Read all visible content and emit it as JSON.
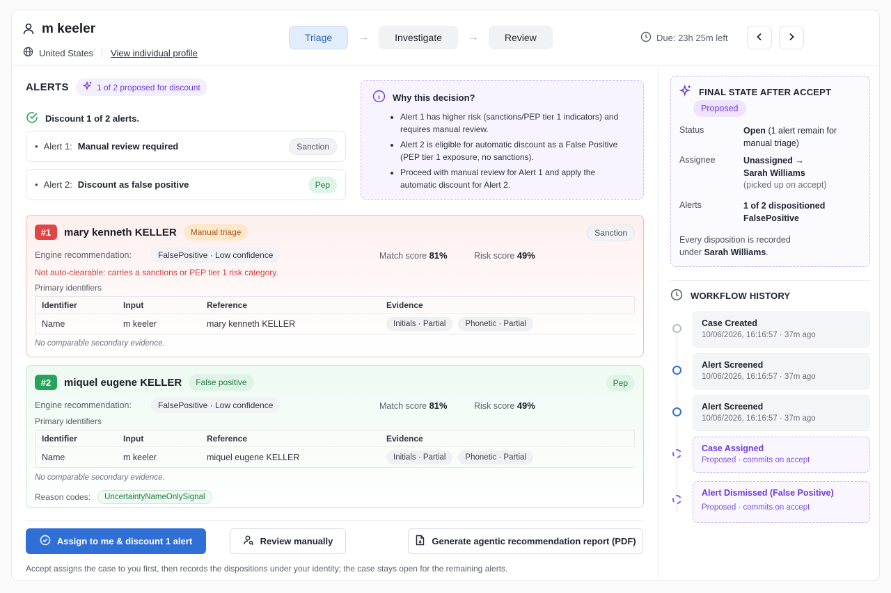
{
  "header": {
    "user_name": "m keeler",
    "country": "United States",
    "profile_link": "View individual profile",
    "steps": [
      {
        "label": "Triage",
        "active": true
      },
      {
        "label": "Investigate",
        "active": false
      },
      {
        "label": "Review",
        "active": false
      }
    ],
    "due": "Due: 23h 25m left"
  },
  "alerts": {
    "title": "ALERTS",
    "proposed_chip": "1 of 2 proposed for discount",
    "discount_summary": "Discount 1 of 2 alerts.",
    "rows": [
      {
        "label": "Alert 1:",
        "value": "Manual review required",
        "tag": "Sanction"
      },
      {
        "label": "Alert 2:",
        "value": "Discount as false positive",
        "tag": "Pep"
      }
    ]
  },
  "why": {
    "title": "Why this decision?",
    "bullets": [
      "Alert 1 has higher risk (sanctions/PEP tier 1 indicators) and requires manual review.",
      "Alert 2 is eligible for automatic discount as a False Positive (PEP tier 1 exposure, no sanctions).",
      "Proceed with manual review for Alert 1 and apply the automatic discount for Alert 2."
    ]
  },
  "cards": [
    {
      "num": "#1",
      "name": "mary kenneth KELLER",
      "status": "Manual triage",
      "type_tag": "Sanction",
      "engine_label": "Engine recommendation:",
      "engine_value": "FalsePositive · Low confidence",
      "match_label": "Match score",
      "match_value": "81%",
      "risk_label": "Risk score",
      "risk_value": "49%",
      "warning": "Not auto-clearable: carries a sanctions or PEP tier 1 risk category.",
      "primary_label": "Primary identifiers",
      "table_headers": [
        "Identifier",
        "Input",
        "Reference",
        "Evidence"
      ],
      "row": {
        "identifier": "Name",
        "input": "m keeler",
        "reference": "mary kenneth KELLER",
        "evidence": [
          "Initials · Partial",
          "Phonetic · Partial"
        ]
      },
      "secondary": "No comparable secondary evidence."
    },
    {
      "num": "#2",
      "name": "miquel eugene KELLER",
      "status": "False positive",
      "type_tag": "Pep",
      "engine_label": "Engine recommendation:",
      "engine_value": "FalsePositive · Low confidence",
      "match_label": "Match score",
      "match_value": "81%",
      "risk_label": "Risk score",
      "risk_value": "49%",
      "primary_label": "Primary identifiers",
      "table_headers": [
        "Identifier",
        "Input",
        "Reference",
        "Evidence"
      ],
      "row": {
        "identifier": "Name",
        "input": "m keeler",
        "reference": "miquel eugene KELLER",
        "evidence": [
          "Initials · Partial",
          "Phonetic · Partial"
        ]
      },
      "secondary": "No comparable secondary evidence.",
      "reason_label": "Reason codes:",
      "reason_value": "UncertaintyNameOnlySignal"
    }
  ],
  "actions": {
    "assign": "Assign to me & discount 1 alert",
    "review": "Review manually",
    "report": "Generate agentic recommendation report (PDF)",
    "footnote": "Accept assigns the case to you first, then records the dispositions under your identity; the case stays open for the remaining alerts."
  },
  "final_state": {
    "title": "FINAL STATE AFTER ACCEPT",
    "tag": "Proposed",
    "status_label": "Status",
    "status_value": "Open",
    "status_note": "(1 alert remain for manual triage)",
    "assignee_label": "Assignee",
    "assignee_value": "Unassigned →",
    "assignee_name": "Sarah Williams",
    "assignee_note": "(picked up on accept)",
    "alerts_label": "Alerts",
    "alerts_value": "1 of 2 dispositioned",
    "alerts_value2": "FalsePositive",
    "every_text": "Every disposition is recorded",
    "every_text2": "under",
    "every_name": "Sarah Williams",
    "every_end": "."
  },
  "workflow": {
    "title": "WORKFLOW HISTORY",
    "events": [
      {
        "title": "Case Created",
        "sub": "10/06/2026, 16:16:57 · 37m ago",
        "kind": "done"
      },
      {
        "title": "Alert Screened",
        "sub": "10/06/2026, 16:16:57 · 37m ago",
        "kind": "blue"
      },
      {
        "title": "Alert Screened",
        "sub": "10/06/2026, 16:16:57 · 37m ago",
        "kind": "blue"
      },
      {
        "title": "Case Assigned",
        "sub": "Proposed · commits on accept",
        "kind": "proposed"
      },
      {
        "title": "Alert Dismissed (False Positive)",
        "sub": "Proposed · commits on accept",
        "kind": "proposed"
      }
    ]
  },
  "colors": {
    "accent": "#2f6fd6",
    "proposed": "#6d3bd6",
    "danger": "#e04444",
    "success": "#28a35c"
  }
}
